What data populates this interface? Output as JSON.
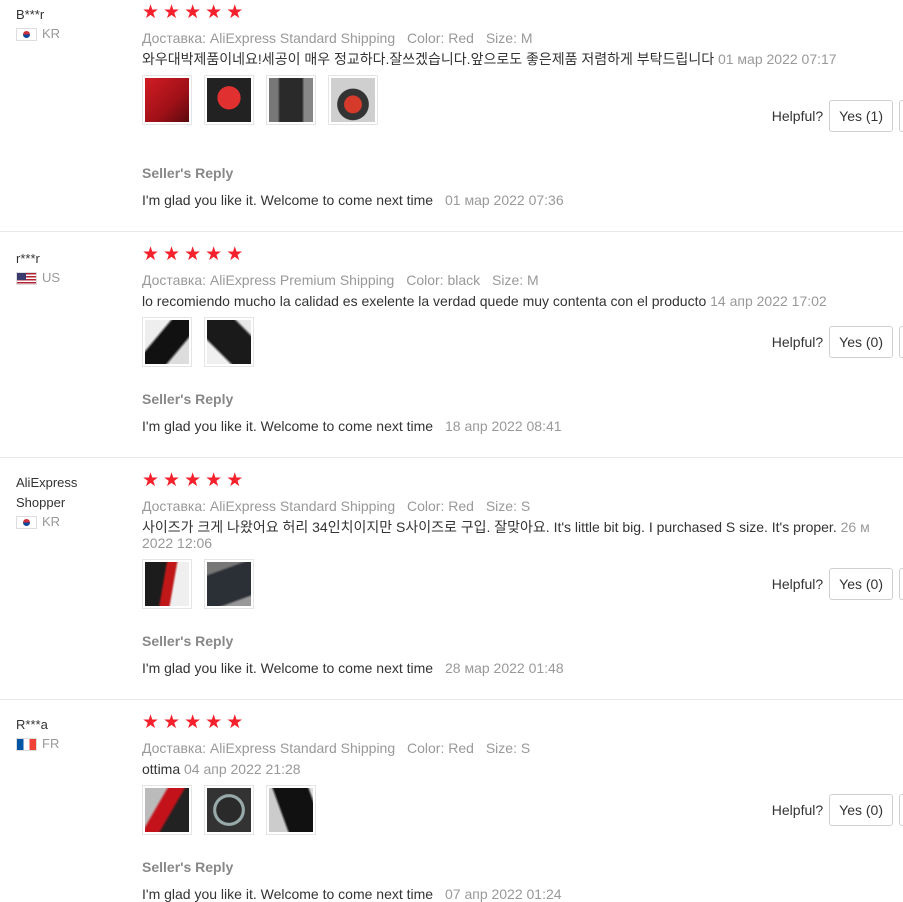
{
  "labels": {
    "helpful": "Helpful?",
    "seller_reply": "Seller's Reply"
  },
  "colors": {
    "star": "#f5222d",
    "muted": "#999999",
    "text": "#333333"
  },
  "reviews": [
    {
      "user": "B***r",
      "country": "KR",
      "rating": 5,
      "shipping": "Доставка: AliExpress Standard Shipping",
      "color": "Color: Red",
      "size": "Size: M",
      "text": "와우대박제품이네요!세공이 매우 정교하다.잘쓰겠습니다.앞으로도 좋은제품 저렴하게 부탁드립니다",
      "date": "01 мар 2022 07:17",
      "photos": 4,
      "helpful_button": "Yes (1)",
      "reply": "I'm glad you like it. Welcome to come next time",
      "reply_date": "01 мар 2022 07:36"
    },
    {
      "user": "r***r",
      "country": "US",
      "rating": 5,
      "shipping": "Доставка: AliExpress Premium Shipping",
      "color": "Color: black",
      "size": "Size: M",
      "text": "lo recomiendo mucho la calidad es exelente la verdad quede muy contenta con el producto",
      "date": "14 апр 2022 17:02",
      "photos": 2,
      "helpful_button": "Yes (0)",
      "reply": "I'm glad you like it. Welcome to come next time",
      "reply_date": "18 апр 2022 08:41"
    },
    {
      "user": "AliExpress Shopper",
      "country": "KR",
      "rating": 5,
      "shipping": "Доставка: AliExpress Standard Shipping",
      "color": "Color: Red",
      "size": "Size: S",
      "text": "사이즈가 크게 나왔어요 허리 34인치이지만 S사이즈로 구입. 잘맞아요. It's little bit big. I purchased S size. It's proper.",
      "date_line1": "26 м",
      "date_line2": "2022 12:06",
      "photos": 2,
      "helpful_button": "Yes (0)",
      "reply": "I'm glad you like it. Welcome to come next time",
      "reply_date": "28 мар 2022 01:48"
    },
    {
      "user": "R***a",
      "country": "FR",
      "rating": 5,
      "shipping": "Доставка: AliExpress Standard Shipping",
      "color": "Color: Red",
      "size": "Size: S",
      "text": "ottima",
      "date": "04 апр 2022 21:28",
      "photos": 3,
      "helpful_button": "Yes (0)",
      "reply": "I'm glad you like it. Welcome to come next time",
      "reply_date": "07 апр 2022 01:24"
    }
  ]
}
